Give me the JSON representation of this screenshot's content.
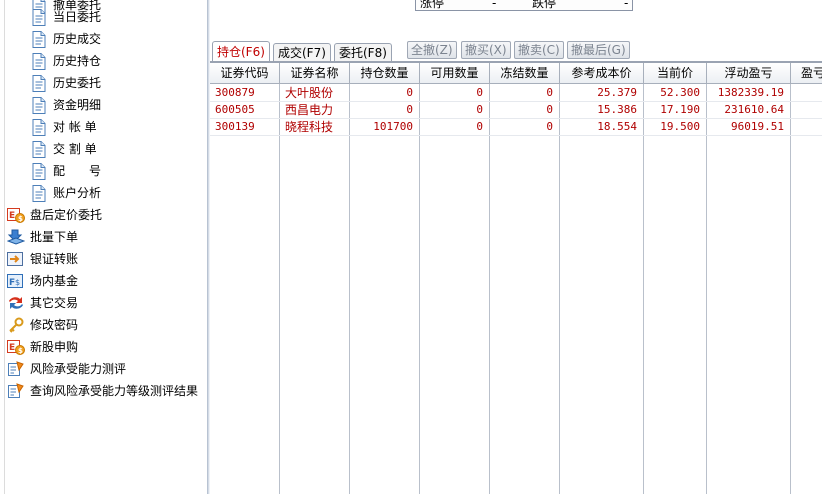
{
  "sidebar": {
    "sub_items": [
      {
        "label": "撤单委托",
        "icon": "document-icon"
      },
      {
        "label": "当日委托",
        "icon": "document-icon"
      },
      {
        "label": "历史成交",
        "icon": "document-icon"
      },
      {
        "label": "历史持仓",
        "icon": "document-icon"
      },
      {
        "label": "历史委托",
        "icon": "document-icon"
      },
      {
        "label": "资金明细",
        "icon": "document-icon"
      },
      {
        "label": "对 帐 单",
        "icon": "document-icon"
      },
      {
        "label": "交 割 单",
        "icon": "document-icon"
      },
      {
        "label": "配　　号",
        "icon": "document-icon"
      },
      {
        "label": "账户分析",
        "icon": "document-icon"
      }
    ],
    "items": [
      {
        "label": "盘后定价委托",
        "icon": "after-hours-order-icon"
      },
      {
        "label": "批量下单",
        "icon": "batch-order-icon"
      },
      {
        "label": "银证转账",
        "icon": "bank-transfer-icon"
      },
      {
        "label": "场内基金",
        "icon": "fund-icon"
      },
      {
        "label": "其它交易",
        "icon": "other-trade-icon"
      },
      {
        "label": "修改密码",
        "icon": "key-icon"
      },
      {
        "label": "新股申购",
        "icon": "ipo-subscribe-icon"
      },
      {
        "label": "风险承受能力测评",
        "icon": "risk-assessment-icon"
      },
      {
        "label": "查询风险承受能力等级测评结果",
        "icon": "risk-result-icon"
      }
    ]
  },
  "quote_strip": {
    "limit_up_label": "涨停",
    "limit_up_value": "-",
    "limit_down_label": "跌停",
    "limit_down_value": "-"
  },
  "tabs": {
    "positions": "持仓(F6)",
    "trades": "成交(F7)",
    "orders": "委托(F8)"
  },
  "buttons": {
    "cancel_all": "全撤(Z)",
    "cancel_buy": "撤买(X)",
    "cancel_sell": "撤卖(C)",
    "cancel_last": "撤最后(G)"
  },
  "table": {
    "columns": [
      "证券代码",
      "证券名称",
      "持仓数量",
      "可用数量",
      "冻结数量",
      "参考成本价",
      "当前价",
      "浮动盈亏",
      "盈亏"
    ],
    "rows": [
      {
        "code": "300879",
        "name": "大叶股份",
        "holding": "0",
        "available": "0",
        "frozen": "0",
        "cost": "25.379",
        "price": "52.300",
        "pnl": "1382339.19"
      },
      {
        "code": "600505",
        "name": "西昌电力",
        "holding": "0",
        "available": "0",
        "frozen": "0",
        "cost": "15.386",
        "price": "17.190",
        "pnl": "231610.64"
      },
      {
        "code": "300139",
        "name": "晓程科技",
        "holding": "101700",
        "available": "0",
        "frozen": "0",
        "cost": "18.554",
        "price": "19.500",
        "pnl": "96019.51"
      }
    ]
  },
  "colors": {
    "active_tab": "#c00000",
    "row_text": "#b00000",
    "disabled_button_text": "#7c8490"
  }
}
